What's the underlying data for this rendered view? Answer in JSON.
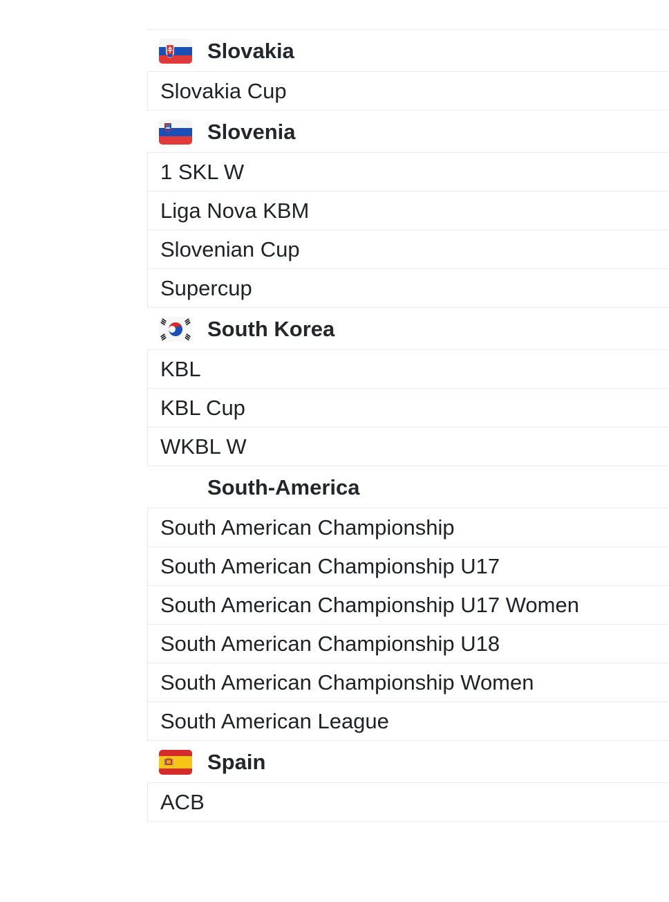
{
  "groups": [
    {
      "country": "Slovakia",
      "flag_icon": "slovakia-flag-icon",
      "leagues": [
        "Slovakia Cup"
      ]
    },
    {
      "country": "Slovenia",
      "flag_icon": "slovenia-flag-icon",
      "leagues": [
        "1 SKL W",
        "Liga Nova KBM",
        "Slovenian Cup",
        "Supercup"
      ]
    },
    {
      "country": "South Korea",
      "flag_icon": "south-korea-flag-icon",
      "leagues": [
        "KBL",
        "KBL Cup",
        "WKBL W"
      ]
    },
    {
      "country": "South-America",
      "flag_icon": "",
      "leagues": [
        "South American Championship",
        "South American Championship U17",
        "South American Championship U17 Women",
        "South American Championship U18",
        "South American Championship Women",
        "South American League"
      ]
    },
    {
      "country": "Spain",
      "flag_icon": "spain-flag-icon",
      "leagues": [
        "ACB"
      ]
    }
  ],
  "colors": {
    "divider": "#ececec",
    "text": "#1e2126",
    "heading_text": "#23272b"
  }
}
